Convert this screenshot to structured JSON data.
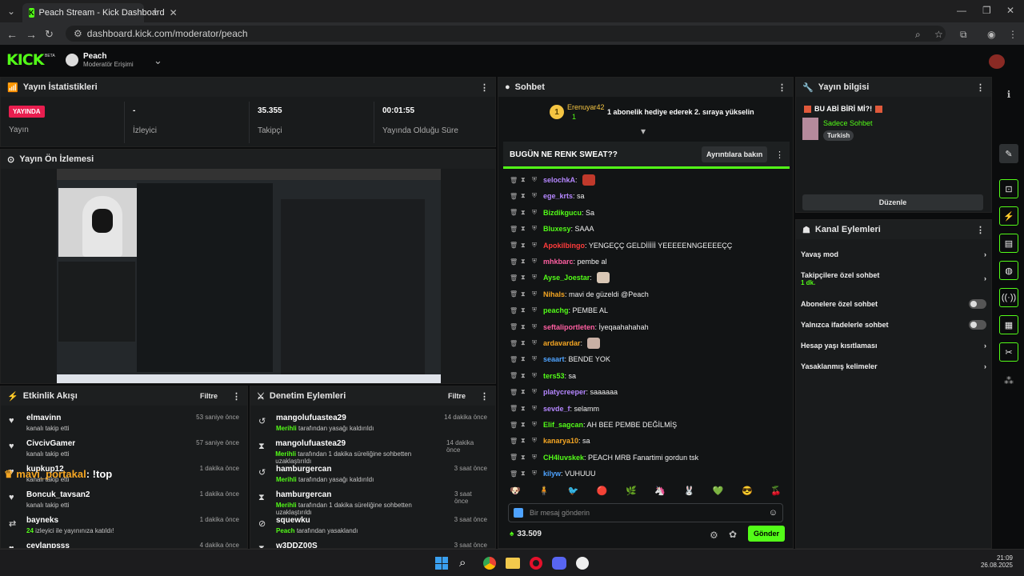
{
  "browser": {
    "tab_title": "Peach Stream - Kick Dashboard",
    "url": "dashboard.kick.com/moderator/peach"
  },
  "header": {
    "logo": "KICK",
    "beta": "BETA",
    "channel": "Peach",
    "role": "Moderatör Erişimi"
  },
  "stats": {
    "title": "Yayın İstatistikleri",
    "live_badge": "YAYINDA",
    "live_label": "Yayın",
    "viewers_val": "-",
    "viewers_label": "İzleyici",
    "followers_val": "35.355",
    "followers_label": "Takipçi",
    "uptime_val": "00:01:55",
    "uptime_label": "Yayında Olduğu Süre"
  },
  "preview": {
    "title": "Yayın Ön İzlemesi"
  },
  "activity": {
    "title": "Etkinlik Akışı",
    "filter": "Filtre",
    "overlay_name": "mavi_portakal",
    "overlay_msg": ": !top",
    "items": [
      {
        "name": "elmavinn",
        "sub": "kanalı takip etti",
        "time": "53 saniye önce"
      },
      {
        "name": "CivcivGamer",
        "sub": "kanalı takip etti",
        "time": "57 saniye önce"
      },
      {
        "name": "kupkup12",
        "sub": "kanalı takip etti",
        "time": "1 dakika önce"
      },
      {
        "name": "Boncuk_tavsan2",
        "sub": "kanalı takip etti",
        "time": "1 dakika önce"
      },
      {
        "name": "bayneks",
        "sub_count": "24",
        "sub": "izleyici ile yayınınıza katıldı!",
        "time": "1 dakika önce"
      },
      {
        "name": "cevlanpsss",
        "sub": "",
        "time": "4 dakika önce"
      }
    ]
  },
  "moderation": {
    "title": "Denetim Eylemleri",
    "filter": "Filtre",
    "items": [
      {
        "name": "mangolufuastea29",
        "actor": "Merihli",
        "sub": "tarafından yasağı kaldırıldı",
        "time": "14 dakika önce"
      },
      {
        "name": "mangolufuastea29",
        "actor": "Merihli",
        "sub": "tarafından 1 dakika süreliğine sohbetten uzaklaştırıldı",
        "time": "14 dakika önce"
      },
      {
        "name": "hamburgercan",
        "actor": "Merihli",
        "sub": "tarafından yasağı kaldırıldı",
        "time": "3 saat önce"
      },
      {
        "name": "hamburgercan",
        "actor": "Merihli",
        "sub": "tarafından 1 dakika süreliğine sohbetten uzaklaştırıldı",
        "time": "3 saat önce"
      },
      {
        "name": "squewku",
        "actor": "Peach",
        "sub": "tarafından yasaklandı",
        "time": "3 saat önce"
      },
      {
        "name": "w3DDZ00S",
        "actor": "",
        "sub": "",
        "time": "3 saat önce"
      }
    ]
  },
  "chat": {
    "title": "Sohbet",
    "gifter": "Erenuyar42",
    "gift_count": "1",
    "gift_msg": "1 abonelik hediye ederek 2. sıraya yükselin",
    "poll_title": "BUGÜN NE RENK SWEAT??",
    "poll_btn": "Ayrıntılara bakın",
    "messages": [
      {
        "user": "selochkA",
        "color": "#b587ff",
        "text": ":",
        "emote": "#c0392b"
      },
      {
        "user": "ege_krts",
        "color": "#b587ff",
        "text": ": sa"
      },
      {
        "user": "Bizdikgucu",
        "color": "#53fc18",
        "text": ": Sa"
      },
      {
        "user": "Bluxesy",
        "color": "#53fc18",
        "text": ": SAAA"
      },
      {
        "user": "Apokilbingo",
        "color": "#ff3b3b",
        "text": ": YENGEÇÇ GELDİİİİİ YEEEEENNGEEEEÇÇ"
      },
      {
        "user": "mhkbarc",
        "color": "#ff5fa2",
        "text": ": pembe al"
      },
      {
        "user": "Ayse_Joestar",
        "color": "#53fc18",
        "text": ":",
        "emote": "#d9c7b5"
      },
      {
        "user": "Nihals",
        "color": "#f5a623",
        "text": ": mavi de güzeldi @Peach"
      },
      {
        "user": "peachg",
        "color": "#53fc18",
        "text": ": PEMBE AL"
      },
      {
        "user": "seftaliportleten",
        "color": "#ff5fa2",
        "text": ": İyeqaahahahah"
      },
      {
        "user": "ardavardar",
        "color": "#f5a623",
        "text": ":",
        "emote": "#c9b0a5"
      },
      {
        "user": "seaart",
        "color": "#4ea3ff",
        "text": ": BENDE YOK"
      },
      {
        "user": "ters53",
        "color": "#53fc18",
        "text": ": sa"
      },
      {
        "user": "platycreeper",
        "color": "#b587ff",
        "text": ": saaaaaa"
      },
      {
        "user": "sevde_f",
        "color": "#b587ff",
        "text": ": selamm"
      },
      {
        "user": "Elif_sagcan",
        "color": "#53fc18",
        "text": ": AH BEE PEMBE DEĞİLMİŞ"
      },
      {
        "user": "kanarya10",
        "color": "#f5a623",
        "text": ": sa"
      },
      {
        "user": "CH4luvskek",
        "color": "#53fc18",
        "text": ": PEACH MRB Fanartimi gordun tsk"
      },
      {
        "user": "kilyw",
        "color": "#4ea3ff",
        "text": ": VUHUUU"
      }
    ],
    "input_placeholder": "Bir mesaj gönderin",
    "points": "33.509",
    "send": "Gönder"
  },
  "info": {
    "title": "Yayın bilgisi",
    "stream_title": "BU ABİ BİRİ Mİ?!",
    "category": "Sadece Sohbet",
    "tag": "Turkish",
    "edit": "Düzenle"
  },
  "channel_actions": {
    "title": "Kanal Eylemleri",
    "slow": "Yavaş mod",
    "followers_only": "Takipçilere özel sohbet",
    "followers_only_sub": "1 dk.",
    "subs_only": "Abonelere özel sohbet",
    "emotes_only": "Yalnızca ifadelerle sohbet",
    "age": "Hesap yaşı kısıtlaması",
    "banned_words": "Yasaklanmış kelimeler"
  },
  "taskbar": {
    "time": "21:09",
    "date": "26.08.2025"
  }
}
